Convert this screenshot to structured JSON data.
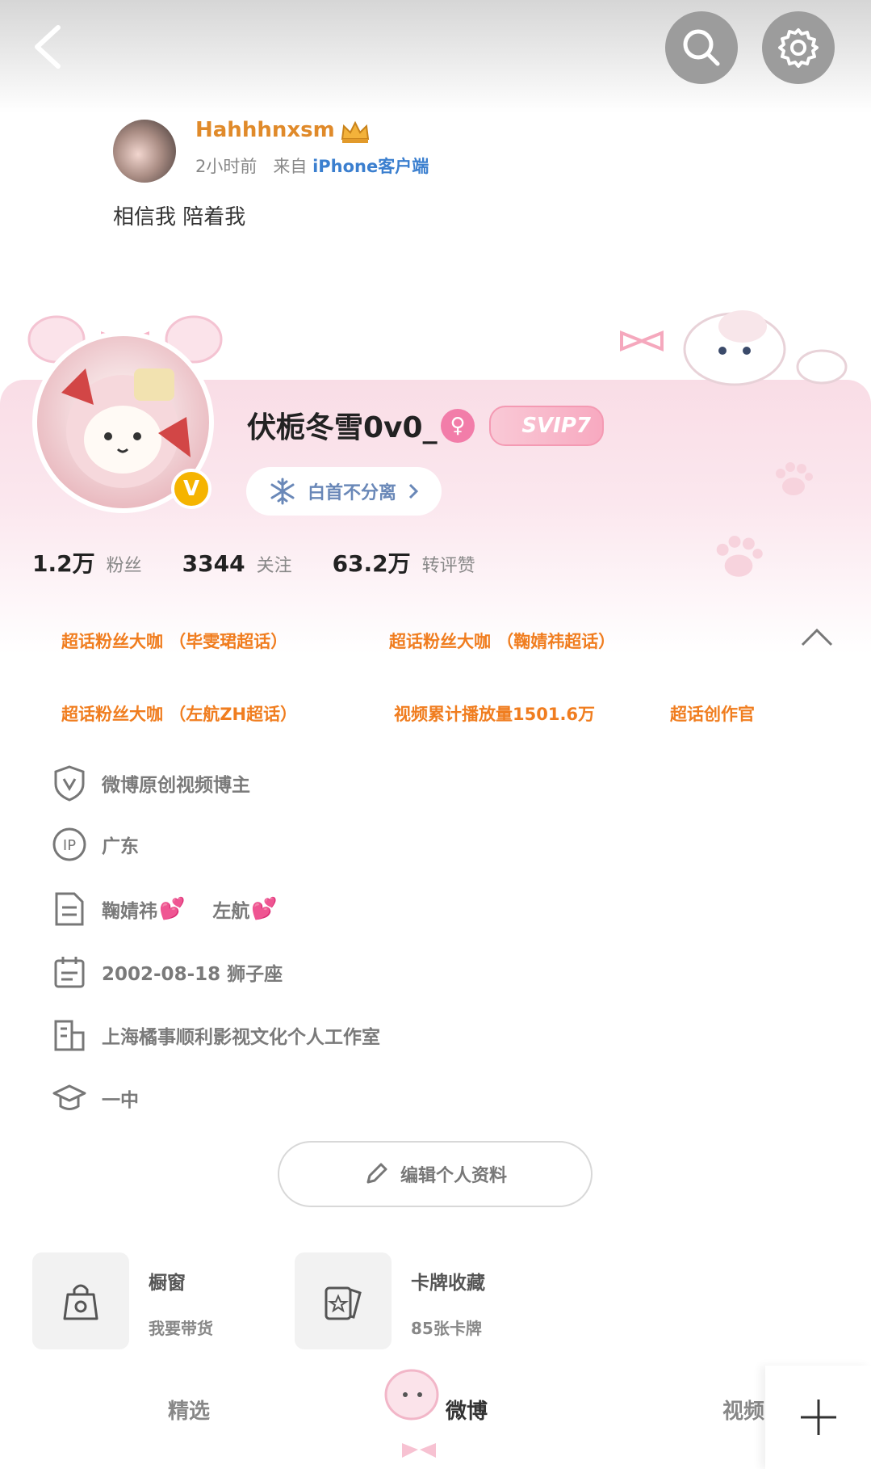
{
  "post": {
    "username": "Hahhhnxsm",
    "time": "2小时前",
    "source_prefix": "来自",
    "source": "iPhone客户端",
    "text": "相信我 陪着我"
  },
  "profile": {
    "nickname": "伏栀冬雪0v0_",
    "gender_symbol": "♀",
    "svip": "SVIP7",
    "verify_badge": "V",
    "fan_group": "白首不分离"
  },
  "stats": [
    {
      "value": "1.2万",
      "label": "粉丝"
    },
    {
      "value": "3344",
      "label": "关注"
    },
    {
      "value": "63.2万",
      "label": "转评赞"
    }
  ],
  "tags": [
    "超话粉丝大咖 （毕雯珺超话）",
    "超话粉丝大咖 （鞠婧祎超话）",
    "超话粉丝大咖 （左航ZH超话）",
    "视频累计播放量1501.6万",
    "超话创作官"
  ],
  "info": {
    "verification": "微博原创视频博主",
    "ip": "广东",
    "bio_1": "鞠婧祎",
    "bio_2": "左航",
    "birthday": "2002-08-18 狮子座",
    "company": "上海橘事顺利影视文化个人工作室",
    "school": "一中"
  },
  "edit_button": "编辑个人资料",
  "tiles": [
    {
      "title": "橱窗",
      "subtitle": "我要带货"
    },
    {
      "title": "卡牌收藏",
      "subtitle": "85张卡牌"
    }
  ],
  "tabs": [
    "精选",
    "微博",
    "视频"
  ],
  "colors": {
    "accent_orange": "#f07d1f",
    "link_blue": "#3b7fcf",
    "pink": "#f27da9"
  }
}
